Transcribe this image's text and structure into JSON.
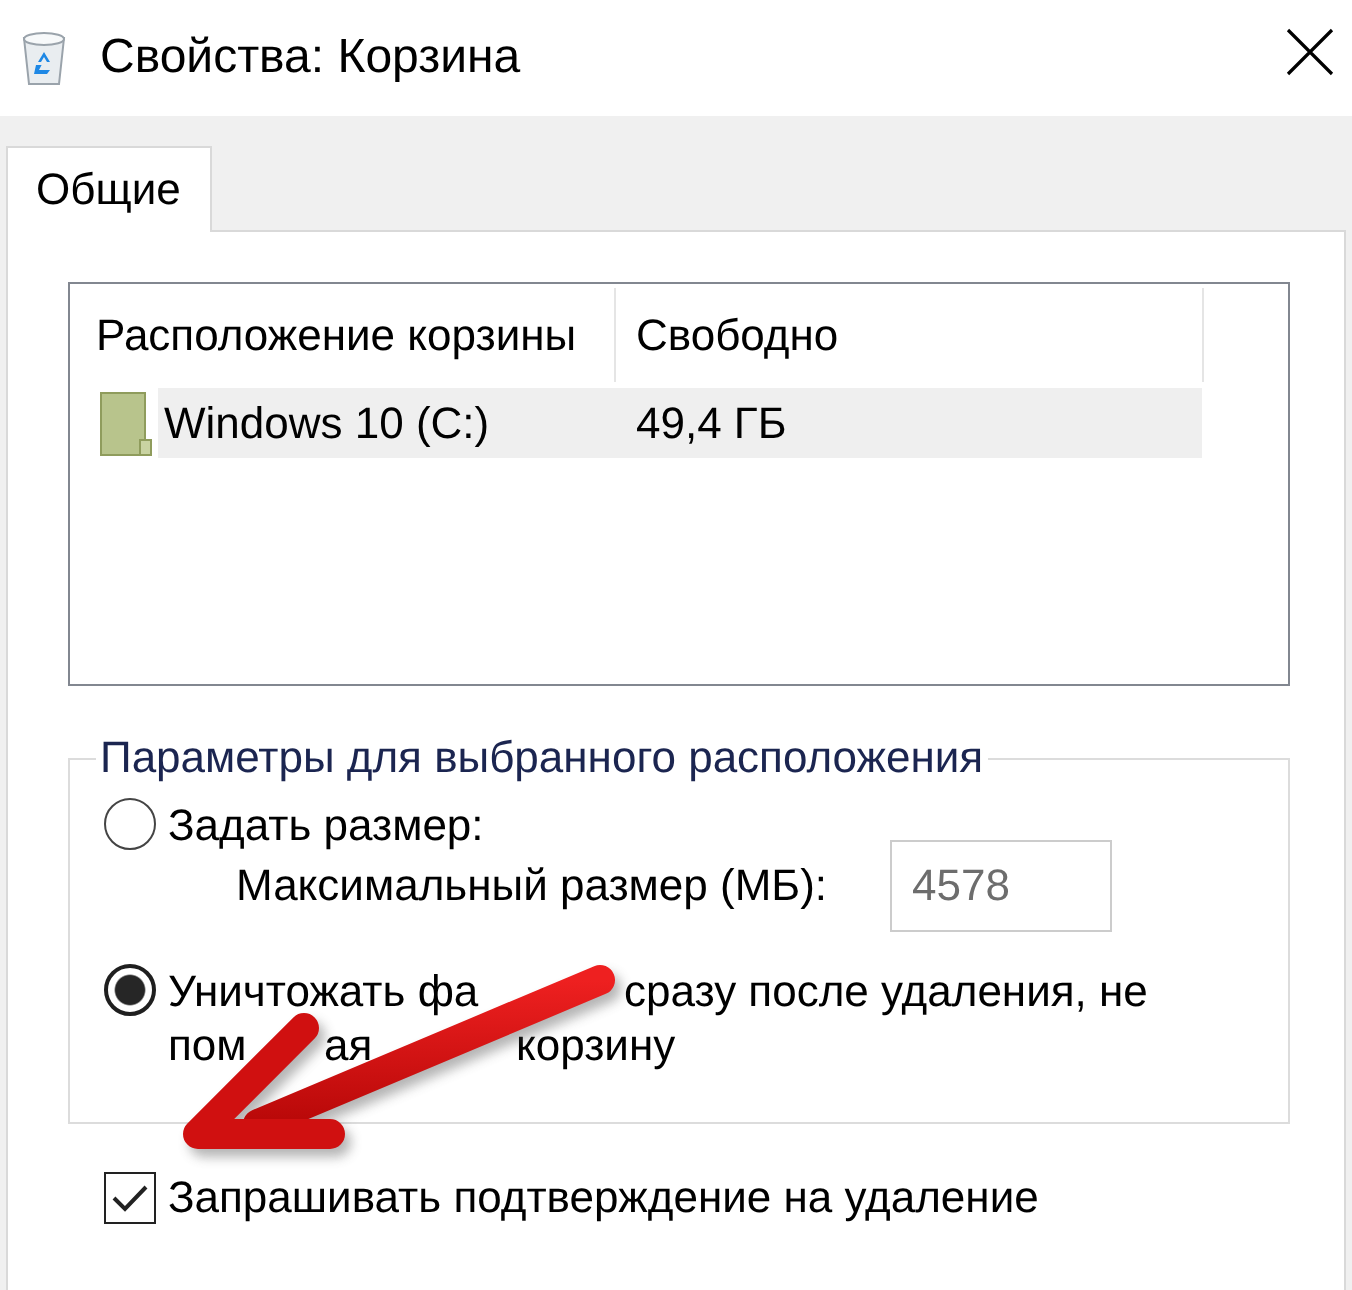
{
  "window": {
    "title": "Свойства: Корзина"
  },
  "tabs": [
    {
      "label": "Общие",
      "selected": true
    }
  ],
  "locations_table": {
    "columns": [
      "Расположение корзины",
      "Свободно"
    ],
    "rows": [
      {
        "cells": [
          "Windows 10 (C:)",
          "49,4 ГБ"
        ],
        "selected": true
      }
    ]
  },
  "options_group": {
    "title": "Параметры для выбранного расположения",
    "options": [
      {
        "selected": false,
        "lines": [
          [
            "Задать размер:"
          ]
        ],
        "field": {
          "label": "Максимальный размер (МБ):",
          "value": "4578",
          "disabled": true
        }
      },
      {
        "selected": true,
        "lines": [
          [
            "Уничтожать фа",
            "сразу после удаления, не"
          ],
          [
            "пом",
            "ая",
            "корзину"
          ]
        ]
      }
    ]
  },
  "confirm_checkbox": {
    "label": "Запрашивать подтверждение на удаление",
    "checked": true
  }
}
